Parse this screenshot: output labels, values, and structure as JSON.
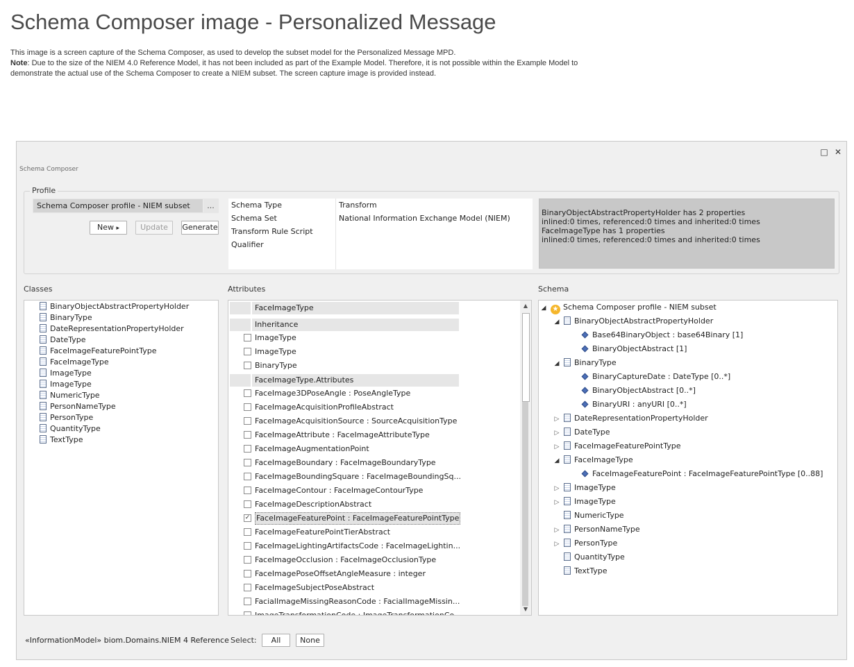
{
  "page": {
    "title": "Schema Composer image - Personalized Message",
    "intro_line1": "This image is a screen capture of the Schema Composer, as used to develop the subset model for the Personalized Message MPD.",
    "note_label": "Note",
    "note_text": ":  Due to the size of the NIEM 4.0 Reference Model, it has not been included as part of the Example Model. Therefore, it is not possible within the Example Model to demonstrate the actual use of the Schema Composer to create a NIEM subset. The screen capture image is provided instead."
  },
  "window": {
    "title": "Schema Composer",
    "maximize_icon": "maximize-icon",
    "close_icon": "close-icon",
    "maximize_glyph": "□",
    "close_glyph": "✕"
  },
  "profile": {
    "legend": "Profile",
    "selected": "Schema Composer profile - NIEM subset",
    "browse_label": "...",
    "new_label": "New",
    "new_arrow": "▸",
    "update_label": "Update",
    "generate_label": "Generate",
    "properties": [
      {
        "name": "Schema Type",
        "value": "Transform"
      },
      {
        "name": "Schema Set",
        "value": "National Information Exchange Model (NIEM)"
      },
      {
        "name": "Transform Rule Script",
        "value": ""
      },
      {
        "name": "Qualifier",
        "value": ""
      }
    ],
    "info": [
      "BinaryObjectAbstractPropertyHolder has 2 properties",
      "inlined:0 times, referenced:0 times and inherited:0 times",
      "FaceImageType has 1 properties",
      "inlined:0 times, referenced:0 times and inherited:0 times"
    ]
  },
  "classes": {
    "label": "Classes",
    "items": [
      "BinaryObjectAbstractPropertyHolder",
      "BinaryType",
      "DateRepresentationPropertyHolder",
      "DateType",
      "FaceImageFeaturePointType",
      "FaceImageType",
      "ImageType",
      "ImageType",
      "NumericType",
      "PersonNameType",
      "PersonType",
      "QuantityType",
      "TextType"
    ]
  },
  "attributes": {
    "label": "Attributes",
    "header": "FaceImageType",
    "inheritance_header": "Inheritance",
    "inherited": [
      "ImageType",
      "ImageType",
      "BinaryType"
    ],
    "attributes_header": "FaceImageType.Attributes",
    "items": [
      {
        "text": "FaceImage3DPoseAngle : PoseAngleType",
        "checked": false
      },
      {
        "text": "FaceImageAcquisitionProfileAbstract",
        "checked": false
      },
      {
        "text": "FaceImageAcquisitionSource : SourceAcquisitionType",
        "checked": false
      },
      {
        "text": "FaceImageAttribute : FaceImageAttributeType",
        "checked": false
      },
      {
        "text": "FaceImageAugmentationPoint",
        "checked": false
      },
      {
        "text": "FaceImageBoundary : FaceImageBoundaryType",
        "checked": false
      },
      {
        "text": "FaceImageBoundingSquare : FaceImageBoundingSq...",
        "checked": false
      },
      {
        "text": "FaceImageContour : FaceImageContourType",
        "checked": false
      },
      {
        "text": "FaceImageDescriptionAbstract",
        "checked": false
      },
      {
        "text": "FaceImageFeaturePoint : FaceImageFeaturePointType",
        "checked": true
      },
      {
        "text": "FaceImageFeaturePointTierAbstract",
        "checked": false
      },
      {
        "text": "FaceImageLightingArtifactsCode : FaceImageLightin...",
        "checked": false
      },
      {
        "text": "FaceImageOcclusion : FaceImageOcclusionType",
        "checked": false
      },
      {
        "text": "FaceImagePoseOffsetAngleMeasure : integer",
        "checked": false
      },
      {
        "text": "FaceImageSubjectPoseAbstract",
        "checked": false
      },
      {
        "text": "FacialImageMissingReasonCode : FacialImageMissin...",
        "checked": false
      },
      {
        "text": "ImageTransformationCode : ImageTransformationCo...",
        "checked": false
      }
    ],
    "check_glyph": "✓",
    "scroll_up": "▲",
    "scroll_down": "▼"
  },
  "schema": {
    "label": "Schema",
    "root": "Schema Composer profile - NIEM subset",
    "root_glyph": "★",
    "expanded_glyph": "◢",
    "collapsed_glyph": "▷",
    "nodes": [
      {
        "label": "BinaryObjectAbstractPropertyHolder",
        "state": "expanded",
        "children": [
          "Base64BinaryObject : base64Binary  [1]",
          "BinaryObjectAbstract [1]"
        ]
      },
      {
        "label": "BinaryType",
        "state": "expanded",
        "children": [
          "BinaryCaptureDate : DateType  [0..*]",
          "BinaryObjectAbstract [0..*]",
          "BinaryURI : anyURI  [0..*]"
        ]
      },
      {
        "label": "DateRepresentationPropertyHolder",
        "state": "collapsed",
        "children": []
      },
      {
        "label": "DateType",
        "state": "collapsed",
        "children": []
      },
      {
        "label": "FaceImageFeaturePointType",
        "state": "collapsed",
        "children": []
      },
      {
        "label": "FaceImageType",
        "state": "expanded",
        "children": [
          "FaceImageFeaturePoint : FaceImageFeaturePointType  [0..88]"
        ]
      },
      {
        "label": "ImageType",
        "state": "collapsed",
        "children": []
      },
      {
        "label": "ImageType",
        "state": "collapsed",
        "children": []
      },
      {
        "label": "NumericType",
        "state": "leaf",
        "children": []
      },
      {
        "label": "PersonNameType",
        "state": "collapsed",
        "children": []
      },
      {
        "label": "PersonType",
        "state": "collapsed",
        "children": []
      },
      {
        "label": "QuantityType",
        "state": "leaf",
        "children": []
      },
      {
        "label": "TextType",
        "state": "leaf",
        "children": []
      }
    ]
  },
  "footer": {
    "model_path": "«InformationModel» biom.Domains.NIEM 4 Reference",
    "select_label": "Select:",
    "all_label": "All",
    "none_label": "None"
  }
}
